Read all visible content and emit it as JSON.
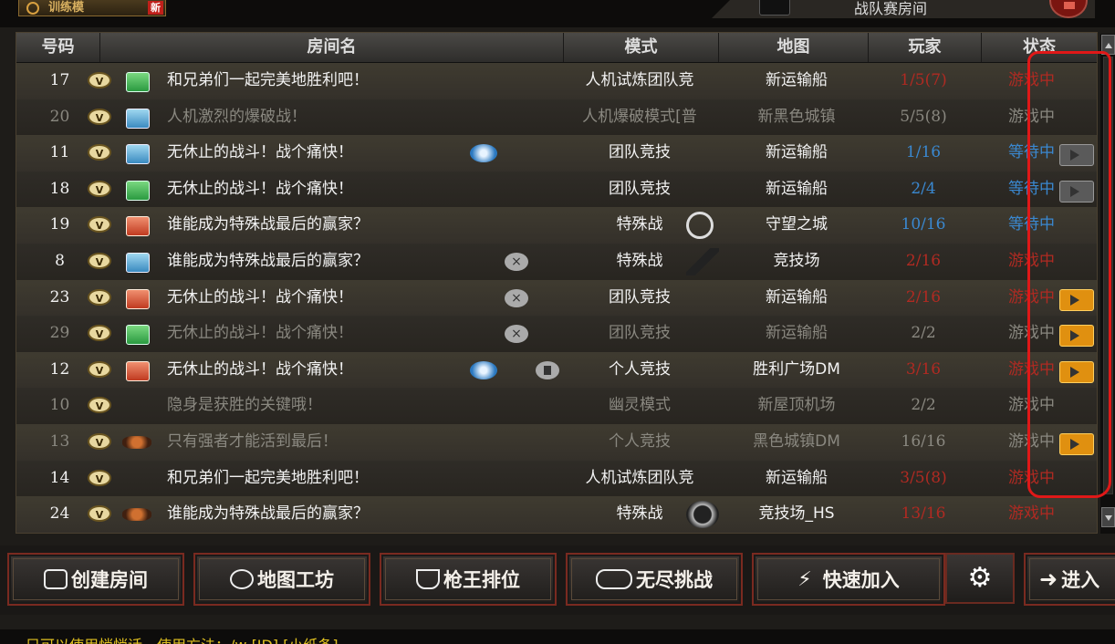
{
  "top": {
    "mode_label": "训练模",
    "new_badge": "新",
    "room_tab": "战队赛房间"
  },
  "colors": {
    "accent_red": "#e01818",
    "waiting_blue": "#3a88d0",
    "full_red": "#b02a22",
    "chat_yellow": "#e0c020"
  },
  "headers": {
    "num": "号码",
    "name": "房间名",
    "mode": "模式",
    "map": "地图",
    "players": "玩家",
    "status": "状态"
  },
  "rooms": [
    {
      "num": "17",
      "icon": "green-box-icon",
      "name": "和兄弟们一起完美地胜利吧！",
      "mode": "人机试炼团队竞",
      "map": "新运输船",
      "players": "1/5(7)",
      "status": "游戏中",
      "tone": "white",
      "ptone": "red",
      "stone": "red"
    },
    {
      "num": "20",
      "icon": "blue-box-icon",
      "name": "人机激烈的爆破战！",
      "mode": "人机爆破模式[普",
      "map": "新黑色城镇",
      "players": "5/5(8)",
      "status": "游戏中",
      "tone": "dim",
      "ptone": "dim",
      "stone": "dim"
    },
    {
      "num": "11",
      "icon": "blue-box-icon",
      "name": "无休止的战斗！战个痛快！",
      "mode": "团队竞技",
      "map": "新运输船",
      "players": "1/16",
      "status": "等待中",
      "tone": "white",
      "ptone": "blue",
      "stone": "blue",
      "play": true,
      "tv": "gray"
    },
    {
      "num": "18",
      "icon": "green-box-icon",
      "name": "无休止的战斗！战个痛快！",
      "mode": "团队竞技",
      "map": "新运输船",
      "players": "2/4",
      "status": "等待中",
      "tone": "white",
      "ptone": "blue",
      "stone": "blue",
      "tv": "gray"
    },
    {
      "num": "19",
      "icon": "red-box-icon",
      "name": "谁能成为特殊战最后的赢家？",
      "mode": "特殊战",
      "map": "守望之城",
      "players": "10/16",
      "status": "等待中",
      "tone": "white",
      "ptone": "blue",
      "stone": "blue",
      "mapicon": "crosshair"
    },
    {
      "num": "8",
      "icon": "blue-box-icon",
      "name": "谁能成为特殊战最后的赢家？",
      "mode": "特殊战",
      "map": "竞技场",
      "players": "2/16",
      "status": "游戏中",
      "tone": "white",
      "ptone": "red",
      "stone": "red",
      "x": true,
      "mapicon": "knife"
    },
    {
      "num": "23",
      "icon": "red-box-icon",
      "name": "无休止的战斗！战个痛快！",
      "mode": "团队竞技",
      "map": "新运输船",
      "players": "2/16",
      "status": "游戏中",
      "tone": "white",
      "ptone": "red",
      "stone": "red",
      "x": true,
      "tv": "orange"
    },
    {
      "num": "29",
      "icon": "green-box-icon",
      "name": "无休止的战斗！战个痛快！",
      "mode": "团队竞技",
      "map": "新运输船",
      "players": "2/2",
      "status": "游戏中",
      "tone": "dim",
      "ptone": "dim",
      "stone": "dim",
      "x": true,
      "tv": "orange"
    },
    {
      "num": "12",
      "icon": "red-box-icon",
      "name": "无休止的战斗！战个痛快！",
      "mode": "个人竞技",
      "map": "胜利广场DM",
      "players": "3/16",
      "status": "游戏中",
      "tone": "white",
      "ptone": "red",
      "stone": "red",
      "play": true,
      "lock": true,
      "tv": "orange"
    },
    {
      "num": "10",
      "icon": "",
      "name": "隐身是获胜的关键哦！",
      "mode": "幽灵模式",
      "map": "新屋顶机场",
      "players": "2/2",
      "status": "游戏中",
      "tone": "dim",
      "ptone": "dim",
      "stone": "dim"
    },
    {
      "num": "13",
      "icon": "wing-emblem-icon",
      "name": "只有强者才能活到最后！",
      "mode": "个人竞技",
      "map": "黑色城镇DM",
      "players": "16/16",
      "status": "游戏中",
      "tone": "dim",
      "ptone": "dim",
      "stone": "dim",
      "tv": "orange"
    },
    {
      "num": "14",
      "icon": "",
      "name": "和兄弟们一起完美地胜利吧！",
      "mode": "人机试炼团队竞",
      "map": "新运输船",
      "players": "3/5(8)",
      "status": "游戏中",
      "tone": "white",
      "ptone": "red",
      "stone": "red"
    },
    {
      "num": "24",
      "icon": "wing-emblem-icon",
      "name": "谁能成为特殊战最后的赢家？",
      "mode": "特殊战",
      "map": "竞技场_HS",
      "players": "13/16",
      "status": "游戏中",
      "tone": "white",
      "ptone": "red",
      "stone": "red",
      "mapicon": "badge"
    }
  ],
  "buttons": {
    "create_room": "创建房间",
    "map_workshop": "地图工坊",
    "gun_king_rank": "枪王排位",
    "endless_challenge": "无尽挑战",
    "quick_join": "快速加入",
    "enter": "进入"
  },
  "chat": {
    "text": "只可以使用悄悄话。使用方法：/w [ID] [小纸条]"
  }
}
